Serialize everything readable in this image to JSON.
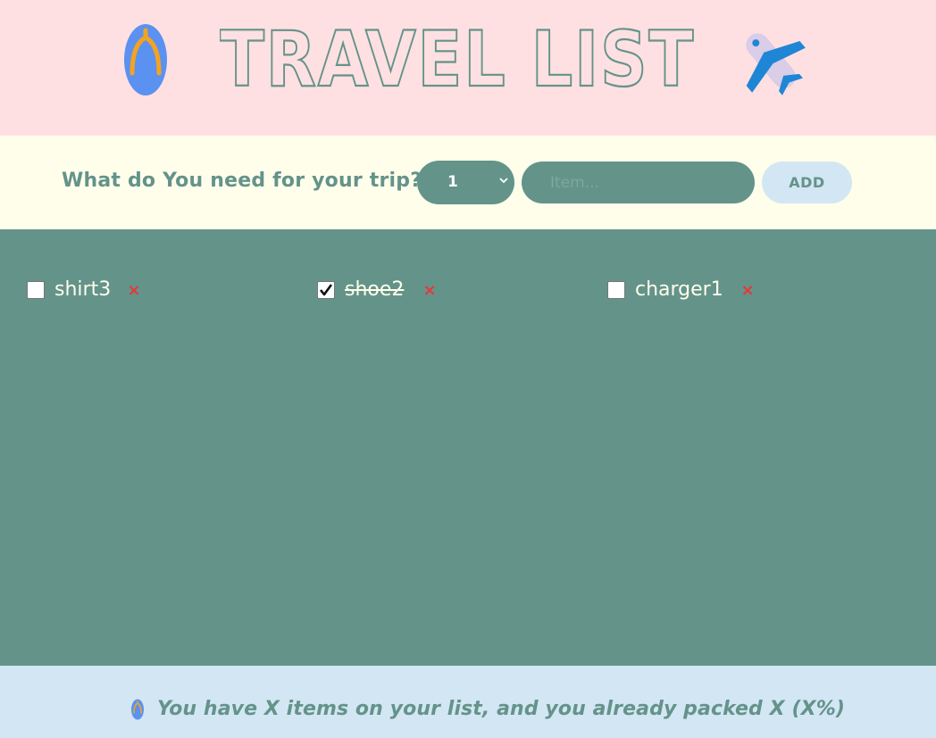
{
  "header": {
    "title": "TRAVEL LIST",
    "left_icon": "flip-flop-icon",
    "right_icon": "airplane-icon"
  },
  "form": {
    "question": "What do You need for your trip?",
    "quantity_value": "1",
    "item_placeholder": "Item...",
    "add_label": "ADD"
  },
  "items": [
    {
      "label": "shirt3",
      "packed": false,
      "remove_glyph": "×"
    },
    {
      "label": "shoe2",
      "packed": true,
      "remove_glyph": "×"
    },
    {
      "label": "charger1",
      "packed": false,
      "remove_glyph": "×"
    }
  ],
  "footer": {
    "stats": "You have X items on your list, and you already packed X (X%)",
    "icon": "flip-flop-icon"
  },
  "colors": {
    "header_bg": "#ffe0e2",
    "form_bg": "#fffeeb",
    "list_bg": "#64938a",
    "footer_bg": "#d3e6f4",
    "accent": "#64938a",
    "remove": "#e5383b"
  }
}
